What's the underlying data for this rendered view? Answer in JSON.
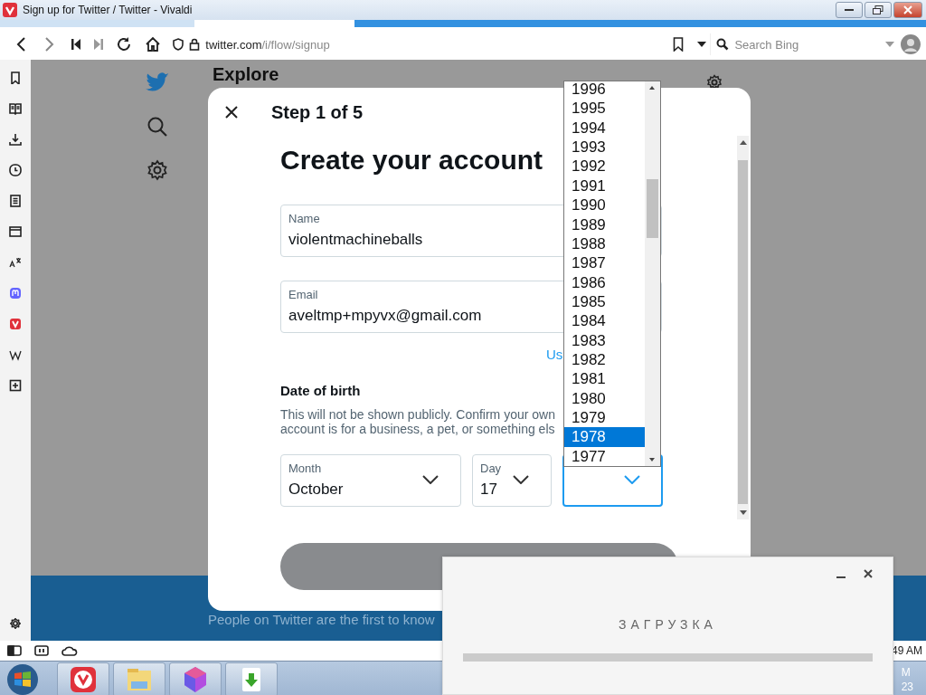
{
  "window": {
    "title": "Sign up for Twitter / Twitter - Vivaldi"
  },
  "toolbar": {
    "address": {
      "domain": "twitter.com",
      "path": "/i/flow/signup"
    },
    "search": {
      "placeholder": "Search Bing"
    }
  },
  "twitter": {
    "header": "Explore",
    "banner_text": "People on Twitter are the first to know"
  },
  "signup_dialog": {
    "step": "Step 1 of 5",
    "heading": "Create your account",
    "fields": [
      {
        "label": "Name",
        "value": "violentmachineballs"
      },
      {
        "label": "Email",
        "value": "aveltmp+mpyvx@gmail.com"
      }
    ],
    "alt_link": "Us",
    "dob_title": "Date of birth",
    "dob_note": [
      "This will not be shown publicly. Confirm your own",
      "account is for a business, a pet, or something els"
    ],
    "selects": [
      {
        "label": "Month",
        "value": "October",
        "focused": false
      },
      {
        "label": "Day",
        "value": "17",
        "focused": false
      },
      {
        "focused": true
      }
    ]
  },
  "year_dropdown": {
    "options": [
      {
        "label": "1996",
        "selected": false
      },
      {
        "label": "1995",
        "selected": false
      },
      {
        "label": "1994",
        "selected": false
      },
      {
        "label": "1993",
        "selected": false
      },
      {
        "label": "1992",
        "selected": false
      },
      {
        "label": "1991",
        "selected": false
      },
      {
        "label": "1990",
        "selected": false
      },
      {
        "label": "1989",
        "selected": false
      },
      {
        "label": "1988",
        "selected": false
      },
      {
        "label": "1987",
        "selected": false
      },
      {
        "label": "1986",
        "selected": false
      },
      {
        "label": "1985",
        "selected": false
      },
      {
        "label": "1984",
        "selected": false
      },
      {
        "label": "1983",
        "selected": false
      },
      {
        "label": "1982",
        "selected": false
      },
      {
        "label": "1981",
        "selected": false
      },
      {
        "label": "1980",
        "selected": false
      },
      {
        "label": "1979",
        "selected": false
      },
      {
        "label": "1978",
        "selected": true
      },
      {
        "label": "1977",
        "selected": false
      }
    ]
  },
  "loader": {
    "title": "ЗАГРУЗКА",
    "level": 0
  },
  "status_bar": {
    "clock": "49 AM"
  },
  "taskbar": {
    "apps": [
      {
        "kind": "vivaldi"
      },
      {
        "kind": "explorer"
      },
      {
        "kind": "gem"
      },
      {
        "kind": "download"
      }
    ],
    "clock": [
      "M",
      "23"
    ]
  }
}
